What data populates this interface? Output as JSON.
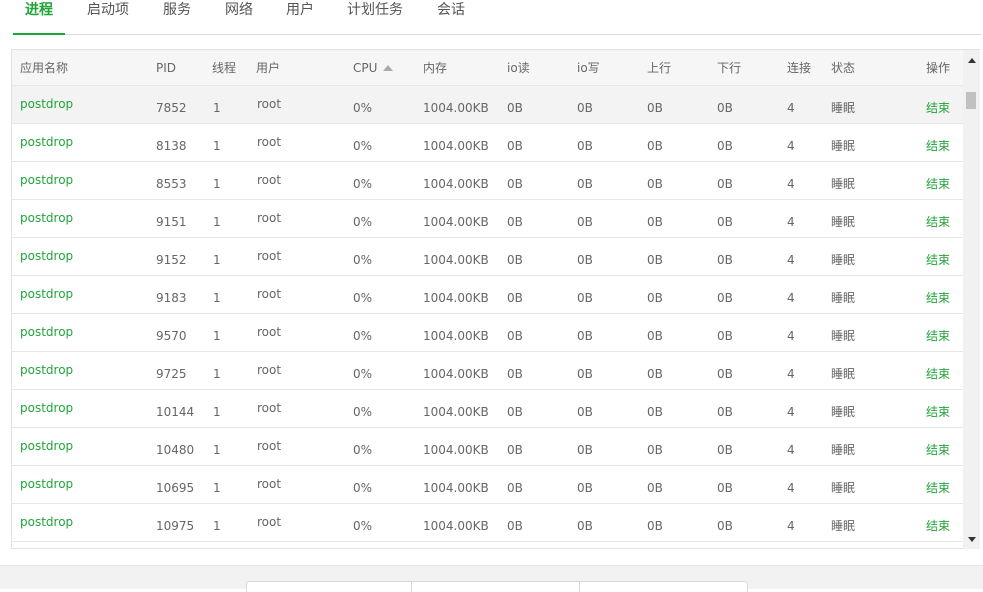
{
  "tabs": [
    {
      "label": "进程",
      "active": true
    },
    {
      "label": "启动项",
      "active": false
    },
    {
      "label": "服务",
      "active": false
    },
    {
      "label": "网络",
      "active": false
    },
    {
      "label": "用户",
      "active": false
    },
    {
      "label": "计划任务",
      "active": false
    },
    {
      "label": "会话",
      "active": false
    }
  ],
  "table": {
    "headers": {
      "name": "应用名称",
      "pid": "PID",
      "threads": "线程",
      "user": "用户",
      "cpu": "CPU",
      "mem": "内存",
      "io_read": "io读",
      "io_write": "io写",
      "up": "上行",
      "down": "下行",
      "conn": "连接",
      "status": "状态",
      "action": "操作"
    },
    "sort": {
      "column": "cpu",
      "direction": "asc"
    },
    "rows": [
      {
        "name": "postdrop",
        "pid": "7852",
        "threads": "1",
        "user": "root",
        "cpu": "0%",
        "mem": "1004.00KB",
        "io_read": "0B",
        "io_write": "0B",
        "up": "0B",
        "down": "0B",
        "conn": "4",
        "status": "睡眠",
        "action": "结束"
      },
      {
        "name": "postdrop",
        "pid": "8138",
        "threads": "1",
        "user": "root",
        "cpu": "0%",
        "mem": "1004.00KB",
        "io_read": "0B",
        "io_write": "0B",
        "up": "0B",
        "down": "0B",
        "conn": "4",
        "status": "睡眠",
        "action": "结束"
      },
      {
        "name": "postdrop",
        "pid": "8553",
        "threads": "1",
        "user": "root",
        "cpu": "0%",
        "mem": "1004.00KB",
        "io_read": "0B",
        "io_write": "0B",
        "up": "0B",
        "down": "0B",
        "conn": "4",
        "status": "睡眠",
        "action": "结束"
      },
      {
        "name": "postdrop",
        "pid": "9151",
        "threads": "1",
        "user": "root",
        "cpu": "0%",
        "mem": "1004.00KB",
        "io_read": "0B",
        "io_write": "0B",
        "up": "0B",
        "down": "0B",
        "conn": "4",
        "status": "睡眠",
        "action": "结束"
      },
      {
        "name": "postdrop",
        "pid": "9152",
        "threads": "1",
        "user": "root",
        "cpu": "0%",
        "mem": "1004.00KB",
        "io_read": "0B",
        "io_write": "0B",
        "up": "0B",
        "down": "0B",
        "conn": "4",
        "status": "睡眠",
        "action": "结束"
      },
      {
        "name": "postdrop",
        "pid": "9183",
        "threads": "1",
        "user": "root",
        "cpu": "0%",
        "mem": "1004.00KB",
        "io_read": "0B",
        "io_write": "0B",
        "up": "0B",
        "down": "0B",
        "conn": "4",
        "status": "睡眠",
        "action": "结束"
      },
      {
        "name": "postdrop",
        "pid": "9570",
        "threads": "1",
        "user": "root",
        "cpu": "0%",
        "mem": "1004.00KB",
        "io_read": "0B",
        "io_write": "0B",
        "up": "0B",
        "down": "0B",
        "conn": "4",
        "status": "睡眠",
        "action": "结束"
      },
      {
        "name": "postdrop",
        "pid": "9725",
        "threads": "1",
        "user": "root",
        "cpu": "0%",
        "mem": "1004.00KB",
        "io_read": "0B",
        "io_write": "0B",
        "up": "0B",
        "down": "0B",
        "conn": "4",
        "status": "睡眠",
        "action": "结束"
      },
      {
        "name": "postdrop",
        "pid": "10144",
        "threads": "1",
        "user": "root",
        "cpu": "0%",
        "mem": "1004.00KB",
        "io_read": "0B",
        "io_write": "0B",
        "up": "0B",
        "down": "0B",
        "conn": "4",
        "status": "睡眠",
        "action": "结束"
      },
      {
        "name": "postdrop",
        "pid": "10480",
        "threads": "1",
        "user": "root",
        "cpu": "0%",
        "mem": "1004.00KB",
        "io_read": "0B",
        "io_write": "0B",
        "up": "0B",
        "down": "0B",
        "conn": "4",
        "status": "睡眠",
        "action": "结束"
      },
      {
        "name": "postdrop",
        "pid": "10695",
        "threads": "1",
        "user": "root",
        "cpu": "0%",
        "mem": "1004.00KB",
        "io_read": "0B",
        "io_write": "0B",
        "up": "0B",
        "down": "0B",
        "conn": "4",
        "status": "睡眠",
        "action": "结束"
      },
      {
        "name": "postdrop",
        "pid": "10975",
        "threads": "1",
        "user": "root",
        "cpu": "0%",
        "mem": "1004.00KB",
        "io_read": "0B",
        "io_write": "0B",
        "up": "0B",
        "down": "0B",
        "conn": "4",
        "status": "睡眠",
        "action": "结束"
      }
    ]
  },
  "colors": {
    "accent": "#20a53a"
  }
}
